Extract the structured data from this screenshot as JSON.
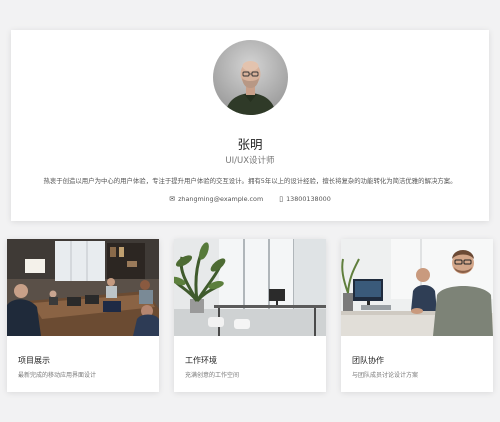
{
  "profile": {
    "name": "张明",
    "title": "UI/UX设计师",
    "bio": "热衷于创造以用户为中心的用户体验，专注于提升用户体验的交互设计。拥有5年以上的设计经验，擅长将复杂的功能转化为简洁优雅的解决方案。",
    "email": "zhangming@example.com",
    "phone": "13800138000",
    "email_icon": "envelope-icon",
    "phone_icon": "mobile-phone-icon"
  },
  "features": [
    {
      "title": "项目展示",
      "desc": "最新完成的移动应用界面设计"
    },
    {
      "title": "工作环境",
      "desc": "充满创意的工作空间"
    },
    {
      "title": "团队协作",
      "desc": "与团队成员讨论设计方案"
    }
  ]
}
